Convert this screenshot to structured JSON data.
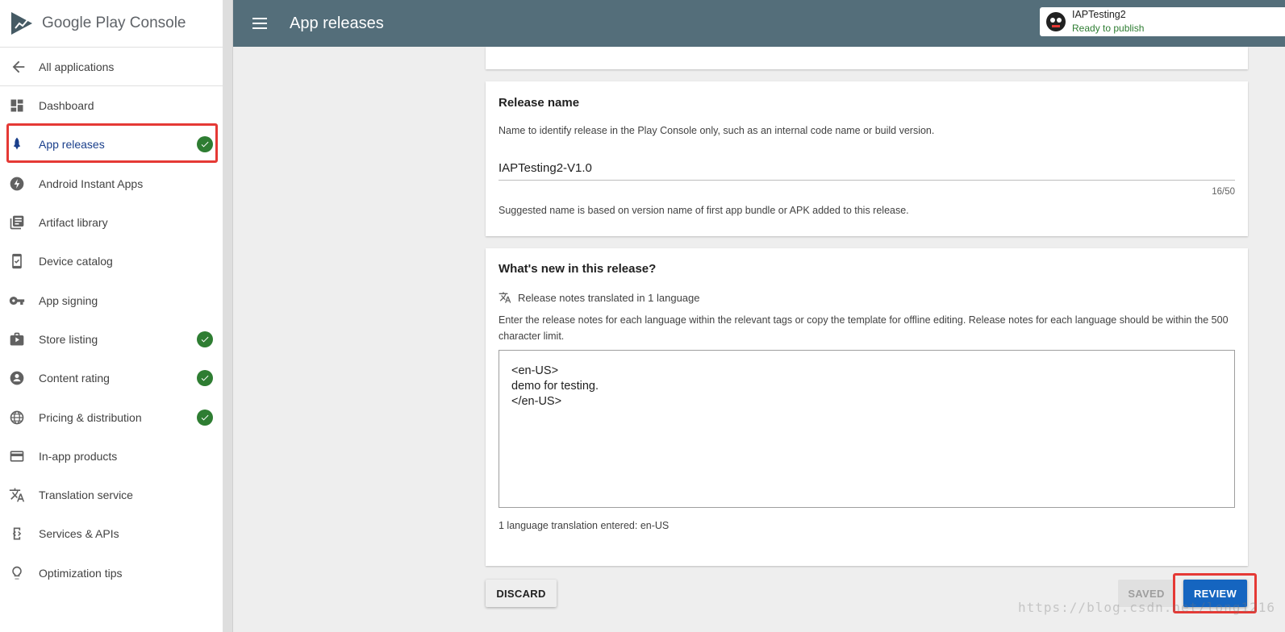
{
  "brand": {
    "logo_text": "Google Play Console"
  },
  "sidebar": {
    "back_label": "All applications",
    "items": [
      {
        "label": "Dashboard",
        "icon": "dashboard-icon",
        "complete": false
      },
      {
        "label": "App releases",
        "icon": "rocket-icon",
        "complete": true,
        "active": true
      },
      {
        "label": "Android Instant Apps",
        "icon": "bolt-icon",
        "complete": false
      },
      {
        "label": "Artifact library",
        "icon": "library-icon",
        "complete": false
      },
      {
        "label": "Device catalog",
        "icon": "device-icon",
        "complete": false
      },
      {
        "label": "App signing",
        "icon": "key-icon",
        "complete": false
      },
      {
        "label": "Store listing",
        "icon": "store-icon",
        "complete": true
      },
      {
        "label": "Content rating",
        "icon": "person-icon",
        "complete": true
      },
      {
        "label": "Pricing & distribution",
        "icon": "globe-icon",
        "complete": true
      },
      {
        "label": "In-app products",
        "icon": "card-icon",
        "complete": false
      },
      {
        "label": "Translation service",
        "icon": "translate-icon",
        "complete": false
      },
      {
        "label": "Services & APIs",
        "icon": "api-icon",
        "complete": false
      },
      {
        "label": "Optimization tips",
        "icon": "bulb-icon",
        "complete": false
      }
    ]
  },
  "header": {
    "title": "App releases",
    "app_name": "IAPTesting2",
    "app_status": "Ready to publish"
  },
  "release_name": {
    "title": "Release name",
    "description": "Name to identify release in the Play Console only, such as an internal code name or build version.",
    "value": "IAPTesting2-V1.0",
    "counter": "16/50",
    "hint": "Suggested name is based on version name of first app bundle or APK added to this release."
  },
  "whats_new": {
    "title": "What's new in this release?",
    "translated_label": "Release notes translated in 1 language",
    "instructions": "Enter the release notes for each language within the relevant tags or copy the template for offline editing. Release notes for each language should be within the 500 character limit.",
    "notes_value": "<en-US>\ndemo for testing.\n</en-US>",
    "languages_entered": "1 language translation entered: en-US"
  },
  "actions": {
    "discard_label": "DISCARD",
    "saved_label": "SAVED",
    "review_label": "REVIEW"
  },
  "watermark": "https://blog.csdn.net/long1216",
  "colors": {
    "header_bg": "#546e7a",
    "active_nav": "#1a3f8b",
    "check_green": "#2e7d32",
    "review_blue": "#1565c0",
    "highlight_red": "#e53935"
  }
}
